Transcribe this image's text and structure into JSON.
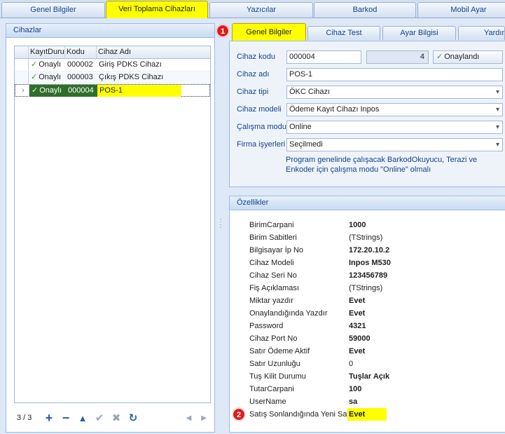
{
  "top_tabs": [
    "Genel Bilgiler",
    "Veri Toplama Cihazları",
    "Yazıcılar",
    "Barkod",
    "Mobil Ayar"
  ],
  "left_panel": {
    "title": "Cihazlar",
    "columns": [
      "KayıtDurumu",
      "Kodu",
      "Cihaz Adı"
    ],
    "rows": [
      {
        "status": "Onaylı",
        "code": "000002",
        "name": "Giriş PDKS Cihazı"
      },
      {
        "status": "Onaylı",
        "code": "000003",
        "name": "Çıkış PDKS Cihazı"
      },
      {
        "status": "Onaylı",
        "code": "000004",
        "name": "POS-1"
      }
    ],
    "record_count": "3 / 3"
  },
  "right_tabs": [
    "Genel Bilgiler",
    "Cihaz Test",
    "Ayar Bilgisi",
    "Yardım"
  ],
  "markers": [
    "1",
    "2"
  ],
  "form": {
    "code_label": "Cihaz kodu",
    "code_value": "000004",
    "code_number": "4",
    "approve_label": "Onaylandı",
    "name_label": "Cihaz adı",
    "name_value": "POS-1",
    "type_label": "Cihaz tipi",
    "type_value": "ÖKC Cihazı",
    "model_label": "Cihaz modeli",
    "model_value": "Ödeme Kayıt Cihazı Inpos",
    "mode_label": "Çalışma modu",
    "mode_value": "Online",
    "firm_label": "Firma işyerleri",
    "firm_value": "Seçilmedi",
    "note": "Program genelinde çalışacak BarkodOkuyucu, Terazi ve Enkoder için çalışma modu \"Online\" olmalı"
  },
  "properties": {
    "title": "Özellikler",
    "items": [
      {
        "key": "BirimCarpani",
        "value": "1000"
      },
      {
        "key": "Birim Sabitleri",
        "value": "(TStrings)"
      },
      {
        "key": "Bilgisayar İp No",
        "value": "172.20.10.2"
      },
      {
        "key": "Cihaz Modeli",
        "value": "Inpos M530"
      },
      {
        "key": "Cihaz Seri No",
        "value": "123456789"
      },
      {
        "key": "Fiş Açıklaması",
        "value": "(TStrings)"
      },
      {
        "key": "Miktar yazdır",
        "value": "Evet"
      },
      {
        "key": "Onaylandığında Yazdır",
        "value": "Evet"
      },
      {
        "key": "Password",
        "value": "4321"
      },
      {
        "key": "Cihaz Port No",
        "value": "59000"
      },
      {
        "key": "Satır Ödeme Aktif",
        "value": "Evet"
      },
      {
        "key": "Satır Uzunluğu",
        "value": "0"
      },
      {
        "key": "Tuş Kilit Durumu",
        "value": "Tuşlar Açık"
      },
      {
        "key": "TutarCarpani",
        "value": "100"
      },
      {
        "key": "UserName",
        "value": "sa"
      },
      {
        "key": "Satış Sonlandığında Yeni Satır",
        "value": "Evet"
      }
    ]
  },
  "colors": {
    "highlight": "#ffff00",
    "marker": "#e01b1b",
    "accent_text": "#15428b"
  }
}
